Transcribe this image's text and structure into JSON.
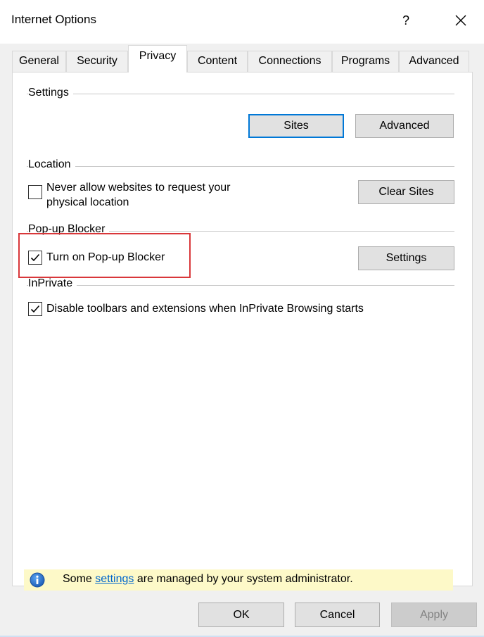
{
  "window": {
    "title": "Internet Options",
    "help_label": "?",
    "close_icon": "close-icon"
  },
  "tabs": [
    {
      "label": "General",
      "active": false
    },
    {
      "label": "Security",
      "active": false
    },
    {
      "label": "Privacy",
      "active": true
    },
    {
      "label": "Content",
      "active": false
    },
    {
      "label": "Connections",
      "active": false
    },
    {
      "label": "Programs",
      "active": false
    },
    {
      "label": "Advanced",
      "active": false
    }
  ],
  "settings_group": {
    "label": "Settings",
    "sites_button": "Sites",
    "advanced_button": "Advanced"
  },
  "location_group": {
    "label": "Location",
    "never_allow_line1": "Never allow websites to request your",
    "never_allow_line2": "physical location",
    "never_allow_checked": false,
    "clear_sites_button": "Clear Sites"
  },
  "popup_group": {
    "label": "Pop-up Blocker",
    "turn_on_label": "Turn on Pop-up Blocker",
    "turn_on_checked": true,
    "settings_button": "Settings"
  },
  "inprivate_group": {
    "label": "InPrivate",
    "disable_label": "Disable toolbars and extensions when InPrivate Browsing starts",
    "disable_checked": true
  },
  "info_bar": {
    "icon": "info-icon",
    "text_before": "Some ",
    "link_text": "settings",
    "text_after": " are managed by your system administrator."
  },
  "footer": {
    "ok_button": "OK",
    "cancel_button": "Cancel",
    "apply_button": "Apply",
    "apply_disabled": true
  },
  "colors": {
    "highlight_border": "#d9373a",
    "focus_border": "#0078d7",
    "info_background": "#fdf9c8",
    "link": "#0066cc"
  }
}
